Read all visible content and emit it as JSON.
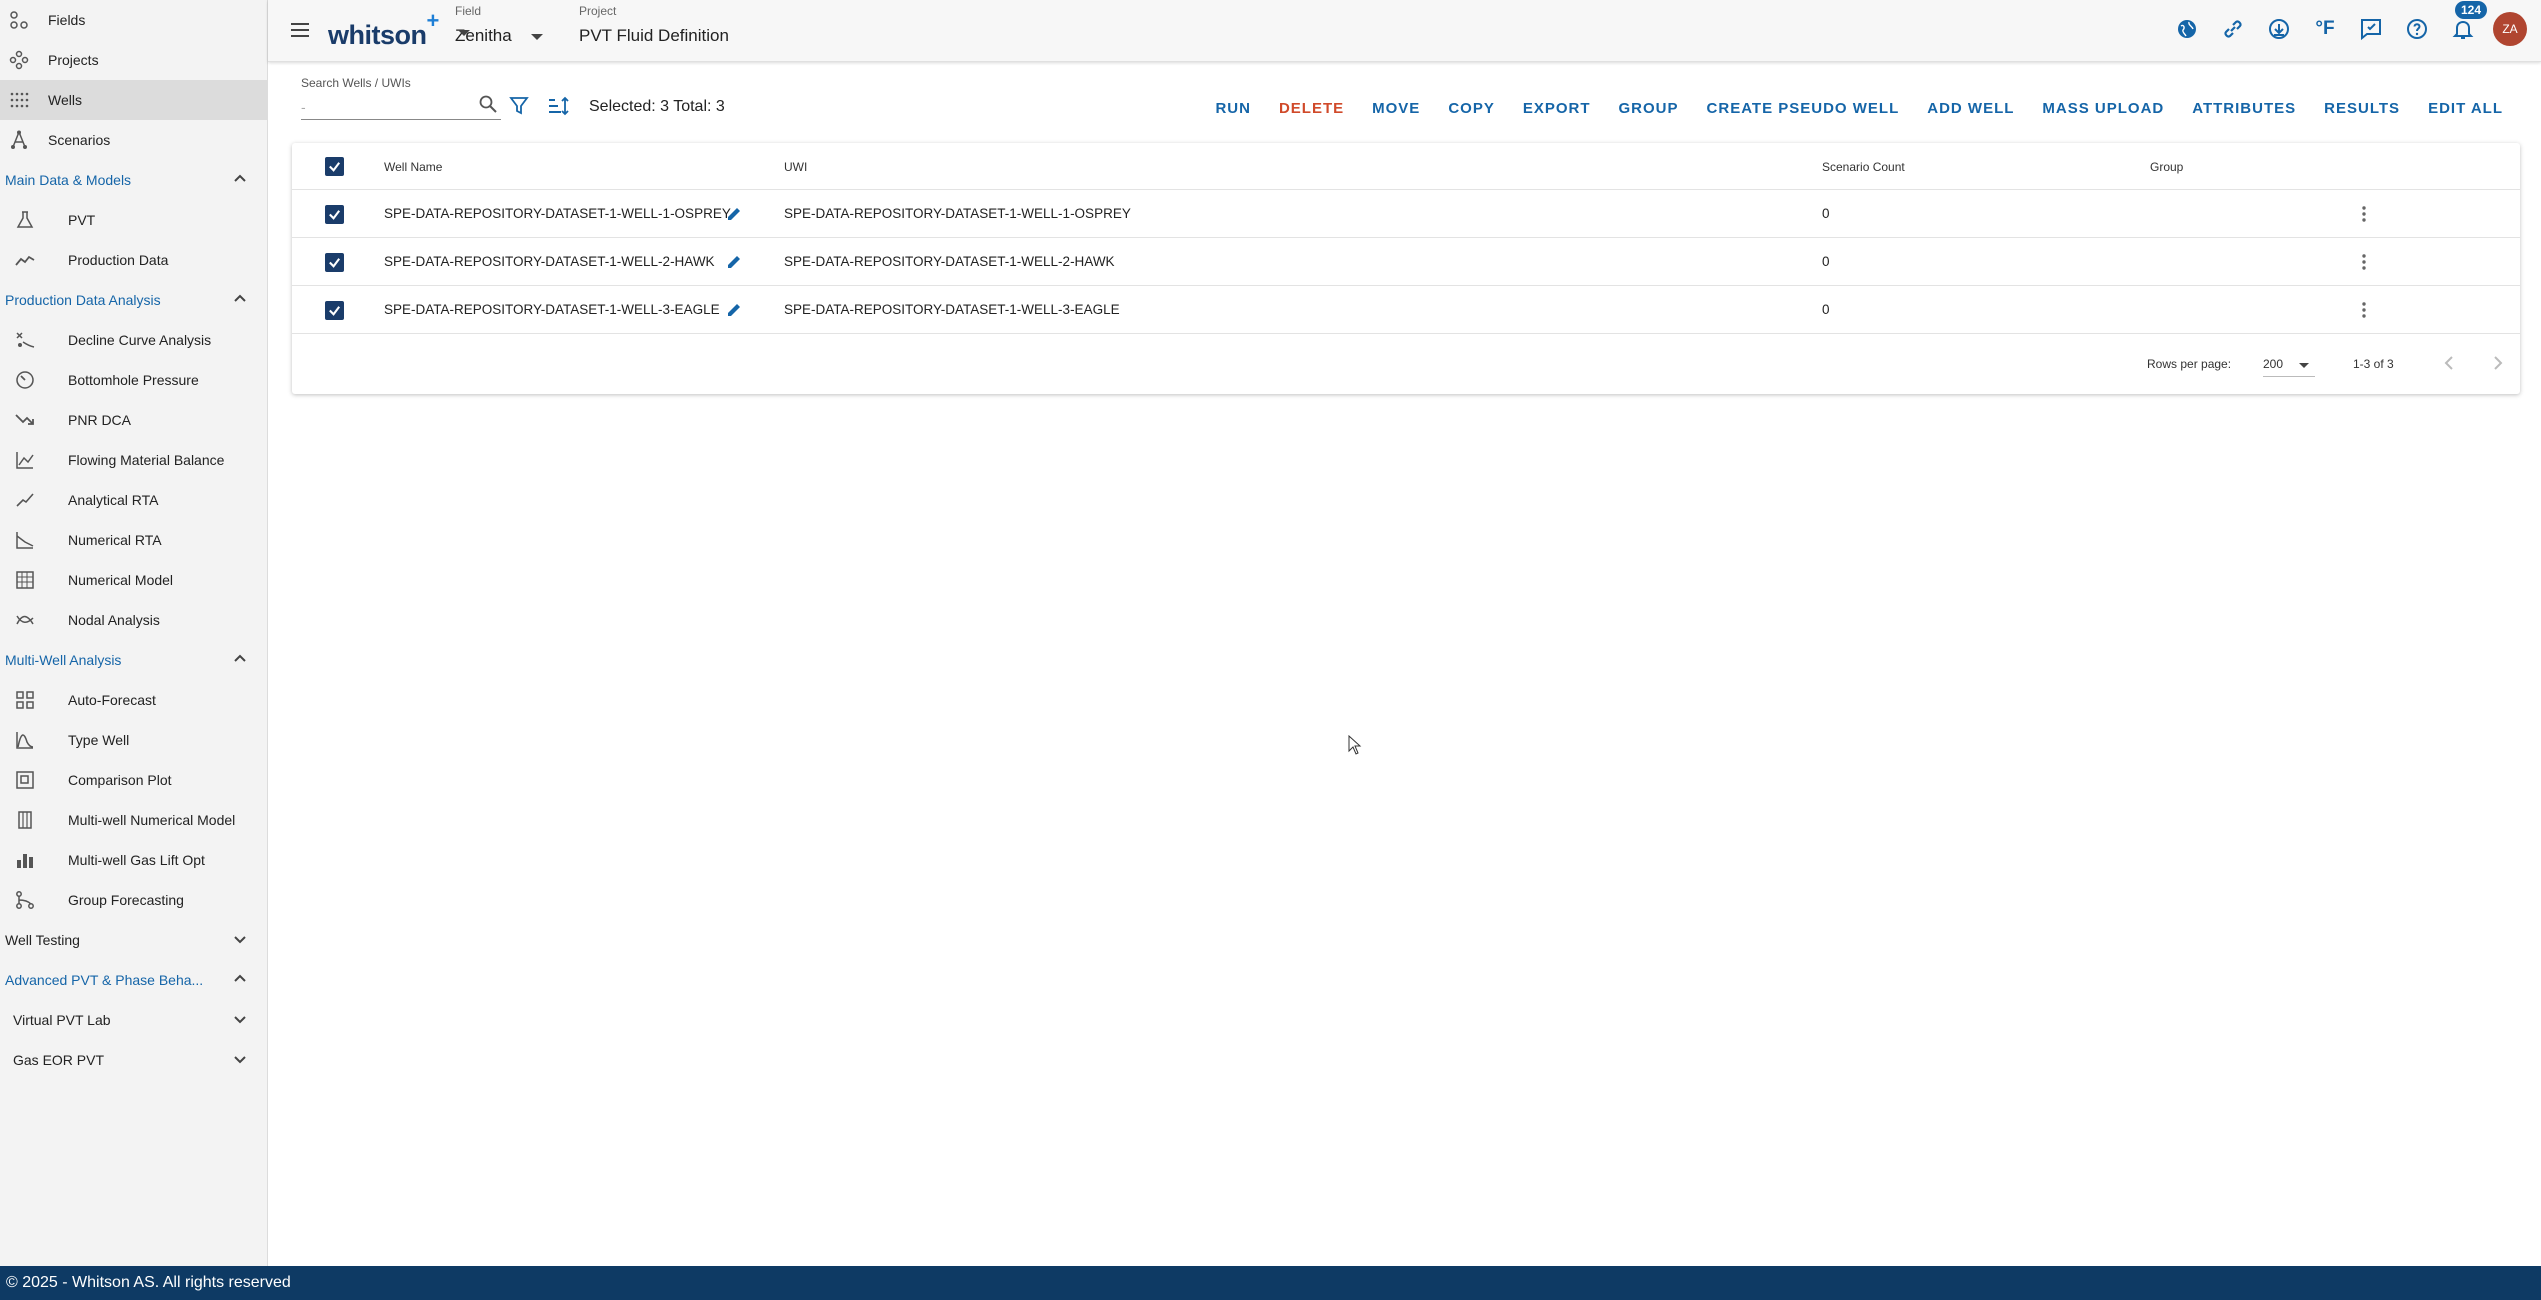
{
  "sidebar": {
    "top_items": [
      {
        "label": "Fields",
        "icon": "fields-icon"
      },
      {
        "label": "Projects",
        "icon": "projects-icon"
      },
      {
        "label": "Wells",
        "icon": "wells-icon",
        "active": true
      },
      {
        "label": "Scenarios",
        "icon": "scenarios-icon"
      }
    ],
    "main_data_models": {
      "title": "Main Data & Models",
      "items": [
        {
          "label": "PVT",
          "icon": "flask-icon"
        },
        {
          "label": "Production Data",
          "icon": "trend-icon"
        }
      ]
    },
    "production_data_analysis": {
      "title": "Production Data Analysis",
      "items": [
        {
          "label": "Decline Curve Analysis",
          "icon": "decline-icon"
        },
        {
          "label": "Bottomhole Pressure",
          "icon": "gauge-icon"
        },
        {
          "label": "PNR DCA",
          "icon": "trending-down-icon"
        },
        {
          "label": "Flowing Material Balance",
          "icon": "chart-line-icon"
        },
        {
          "label": "Analytical RTA",
          "icon": "line-up-icon"
        },
        {
          "label": "Numerical RTA",
          "icon": "area-chart-icon"
        },
        {
          "label": "Numerical Model",
          "icon": "grid-building-icon"
        },
        {
          "label": "Nodal Analysis",
          "icon": "crossing-curves-icon"
        }
      ]
    },
    "multi_well_analysis": {
      "title": "Multi-Well Analysis",
      "items": [
        {
          "label": "Auto-Forecast",
          "icon": "grid-icon"
        },
        {
          "label": "Type Well",
          "icon": "bell-curve-icon"
        },
        {
          "label": "Comparison Plot",
          "icon": "compare-icon"
        },
        {
          "label": "Multi-well Numerical Model",
          "icon": "columns-icon"
        },
        {
          "label": "Multi-well Gas Lift Opt",
          "icon": "bar-chart-icon"
        },
        {
          "label": "Group Forecasting",
          "icon": "branch-icon"
        }
      ]
    },
    "well_testing": {
      "title": "Well Testing"
    },
    "advanced_pvt": {
      "title": "Advanced PVT & Phase Beha...",
      "items": [
        {
          "label": "Virtual PVT Lab"
        },
        {
          "label": "Gas EOR PVT"
        }
      ]
    }
  },
  "header": {
    "logo": "whitson",
    "logo_plus": "+",
    "field_label": "Field",
    "field_value": "Zenitha",
    "project_label": "Project",
    "project_value": "PVT Fluid Definition",
    "temp_unit": "°F",
    "notification_count": "124",
    "avatar_initials": "ZA"
  },
  "toolbar": {
    "search_label": "Search Wells / UWIs",
    "search_placeholder": "-",
    "selection_summary": "Selected: 3 Total: 3",
    "actions": {
      "run": "RUN",
      "delete": "DELETE",
      "move": "MOVE",
      "copy": "COPY",
      "export": "EXPORT",
      "group": "GROUP",
      "create_pseudo_well": "CREATE PSEUDO WELL",
      "add_well": "ADD WELL",
      "mass_upload": "MASS UPLOAD",
      "attributes": "ATTRIBUTES",
      "results": "RESULTS",
      "edit_all": "EDIT ALL"
    }
  },
  "table": {
    "columns": {
      "well_name": "Well Name",
      "uwi": "UWI",
      "scenario_count": "Scenario Count",
      "group": "Group"
    },
    "rows": [
      {
        "well_name": "SPE-DATA-REPOSITORY-DATASET-1-WELL-1-OSPREY",
        "uwi": "SPE-DATA-REPOSITORY-DATASET-1-WELL-1-OSPREY",
        "scenario_count": "0",
        "group": ""
      },
      {
        "well_name": "SPE-DATA-REPOSITORY-DATASET-1-WELL-2-HAWK",
        "uwi": "SPE-DATA-REPOSITORY-DATASET-1-WELL-2-HAWK",
        "scenario_count": "0",
        "group": ""
      },
      {
        "well_name": "SPE-DATA-REPOSITORY-DATASET-1-WELL-3-EAGLE",
        "uwi": "SPE-DATA-REPOSITORY-DATASET-1-WELL-3-EAGLE",
        "scenario_count": "0",
        "group": ""
      }
    ],
    "pagination": {
      "rows_per_page_label": "Rows per page:",
      "rows_per_page_value": "200",
      "range": "1-3 of 3"
    }
  },
  "footer": {
    "copyright": "© 2025 - Whitson AS. All rights reserved"
  },
  "colors": {
    "accent": "#1565a8",
    "navy": "#1a3c6a",
    "danger": "#d04a2a",
    "footer_bg": "#0e3a64"
  }
}
